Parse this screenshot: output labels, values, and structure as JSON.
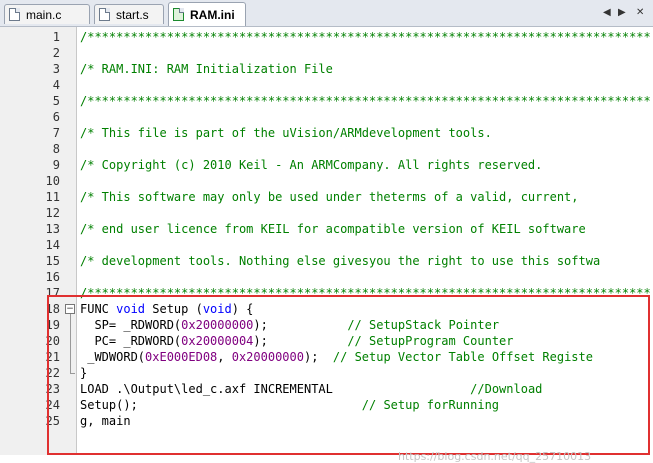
{
  "tabs": [
    {
      "label": "main.c",
      "active": false
    },
    {
      "label": "start.s",
      "active": false
    },
    {
      "label": "RAM.ini",
      "active": true
    }
  ],
  "nav": {
    "left_arrow": "◀",
    "right_arrow": "▶",
    "close": "✕"
  },
  "lines": [
    {
      "n": "1",
      "seg": [
        {
          "t": "/******************************************************************************",
          "c": "cmt"
        }
      ]
    },
    {
      "n": "2",
      "seg": []
    },
    {
      "n": "3",
      "seg": [
        {
          "t": "/* RAM.INI: RAM Initialization File",
          "c": "cmt"
        }
      ]
    },
    {
      "n": "4",
      "seg": []
    },
    {
      "n": "5",
      "seg": [
        {
          "t": "/******************************************************************************",
          "c": "cmt"
        }
      ]
    },
    {
      "n": "6",
      "seg": []
    },
    {
      "n": "7",
      "seg": [
        {
          "t": "/* This file is part of the uVision/ARMdevelopment tools.",
          "c": "cmt"
        }
      ]
    },
    {
      "n": "8",
      "seg": []
    },
    {
      "n": "9",
      "seg": [
        {
          "t": "/* Copyright (c) 2010 Keil - An ARMCompany. All rights reserved.",
          "c": "cmt"
        }
      ]
    },
    {
      "n": "10",
      "seg": []
    },
    {
      "n": "11",
      "seg": [
        {
          "t": "/* This software may only be used under theterms of a valid, current,",
          "c": "cmt"
        }
      ]
    },
    {
      "n": "12",
      "seg": []
    },
    {
      "n": "13",
      "seg": [
        {
          "t": "/* end user licence from KEIL for acompatible version of KEIL software",
          "c": "cmt"
        }
      ]
    },
    {
      "n": "14",
      "seg": []
    },
    {
      "n": "15",
      "seg": [
        {
          "t": "/* development tools. Nothing else givesyou the right to use this softwa",
          "c": "cmt"
        }
      ]
    },
    {
      "n": "16",
      "seg": []
    },
    {
      "n": "17",
      "seg": [
        {
          "t": "/******************************************************************************",
          "c": "cmt"
        }
      ]
    },
    {
      "n": "18",
      "seg": [
        {
          "t": "FUNC ",
          "c": ""
        },
        {
          "t": "void",
          "c": "kw"
        },
        {
          "t": " Setup (",
          "c": ""
        },
        {
          "t": "void",
          "c": "kw"
        },
        {
          "t": ") {",
          "c": ""
        }
      ]
    },
    {
      "n": "19",
      "seg": [
        {
          "t": "  SP= _RDWORD(",
          "c": ""
        },
        {
          "t": "0x20000000",
          "c": "num"
        },
        {
          "t": ");           ",
          "c": ""
        },
        {
          "t": "// SetupStack Pointer",
          "c": "cmt"
        }
      ]
    },
    {
      "n": "20",
      "seg": [
        {
          "t": "  PC= _RDWORD(",
          "c": ""
        },
        {
          "t": "0x20000004",
          "c": "num"
        },
        {
          "t": ");           ",
          "c": ""
        },
        {
          "t": "// SetupProgram Counter",
          "c": "cmt"
        }
      ]
    },
    {
      "n": "21",
      "seg": [
        {
          "t": " _WDWORD(",
          "c": ""
        },
        {
          "t": "0xE000ED08",
          "c": "num"
        },
        {
          "t": ", ",
          "c": ""
        },
        {
          "t": "0x20000000",
          "c": "num"
        },
        {
          "t": ");  ",
          "c": ""
        },
        {
          "t": "// Setup Vector Table Offset Registe",
          "c": "cmt"
        }
      ]
    },
    {
      "n": "22",
      "seg": [
        {
          "t": "}",
          "c": ""
        }
      ]
    },
    {
      "n": "23",
      "seg": [
        {
          "t": "LOAD .\\Output\\led_c.axf INCREMENTAL                   ",
          "c": ""
        },
        {
          "t": "//Download",
          "c": "cmt"
        }
      ]
    },
    {
      "n": "24",
      "seg": [
        {
          "t": "Setup();                               ",
          "c": ""
        },
        {
          "t": "// Setup forRunning",
          "c": "cmt"
        }
      ]
    },
    {
      "n": "25",
      "seg": [
        {
          "t": "g, main",
          "c": ""
        }
      ]
    }
  ],
  "watermark": "https://blog.csdn.net/qq_25710013"
}
